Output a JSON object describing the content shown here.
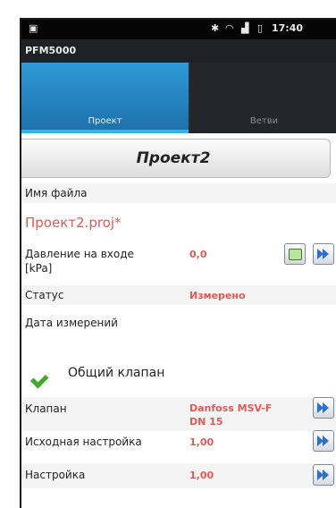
{
  "statusbar": {
    "time": "17:40"
  },
  "app": {
    "title": "PFM5000"
  },
  "tabs": [
    {
      "label": "Проект"
    },
    {
      "label": "Ветви"
    }
  ],
  "project_button": {
    "label": "Проект2"
  },
  "file": {
    "label": "Имя файла",
    "value": "Проект2.proj*"
  },
  "pressure": {
    "label_line1": "Давление на входе",
    "label_line2": "[kPa]",
    "value": "0,0"
  },
  "status": {
    "label": "Статус",
    "value": "Измерено"
  },
  "date": {
    "label": "Дата измерений"
  },
  "common_valve": {
    "label": "Общий клапан"
  },
  "valve": {
    "label": "Клапан",
    "value_line1": "Danfoss MSV-F",
    "value_line2": "DN 15"
  },
  "initial_setting": {
    "label": "Исходная настройка",
    "value": "1,00"
  },
  "setting": {
    "label": "Настройка",
    "value": "1,00"
  }
}
